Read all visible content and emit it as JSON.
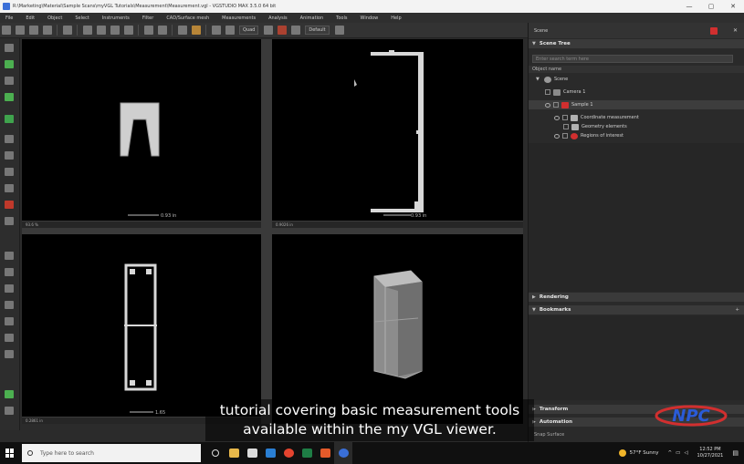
{
  "window": {
    "title": "R:\\Marketing\\Material\\Sample Scans\\myVGL Tutorials\\Measurement\\Measurement.vgl - VGSTUDIO MAX 3.5.0 64 bit",
    "controls": [
      "—",
      "▢",
      "✕"
    ]
  },
  "menu": [
    "File",
    "Edit",
    "Object",
    "Select",
    "Instruments",
    "Filter",
    "CAD/Surface mesh",
    "Measurements",
    "Analysis",
    "Animation",
    "Tools",
    "Window",
    "Help"
  ],
  "toolbar": {
    "view_combo": "Quad",
    "default_combo": "Default"
  },
  "right_pane": {
    "top_label": "Scene",
    "scene_tree_title": "Scene Tree",
    "search_placeholder": "Enter search term here",
    "column_header": "Object name",
    "tree": [
      {
        "label": "Scene",
        "level": 0
      },
      {
        "label": "Camera 1",
        "level": 1
      },
      {
        "label": "Sample 1",
        "level": 1
      },
      {
        "label": "Coordinate measurement",
        "level": 2
      },
      {
        "label": "Geometry elements",
        "level": 3
      },
      {
        "label": "Regions of interest",
        "level": 2
      }
    ],
    "rendering_title": "Rendering",
    "bookmarks_title": "Bookmarks",
    "transform_title": "Transform",
    "automation_title": "Automation",
    "snap_label": "Snap Surface"
  },
  "viewports": {
    "tl_scale": "0.93 in",
    "tr_scale": "0.93 in",
    "bl_scale": "1.65",
    "tl_zoom": "93.6 %",
    "tr_zoom": "0.9026 in",
    "bl_zoom": "0.2861 in"
  },
  "caption": {
    "line1": "tutorial covering basic measurement tools",
    "line2": "available within the my VGL viewer."
  },
  "watermark": "NPC",
  "taskbar": {
    "search_placeholder": "Type here to search",
    "weather": "57°F  Sunny",
    "time": "12:52 PM",
    "date": "10/27/2021"
  },
  "colors": {
    "accent_red": "#d12f2f",
    "accent_blue": "#2a5bd7"
  }
}
